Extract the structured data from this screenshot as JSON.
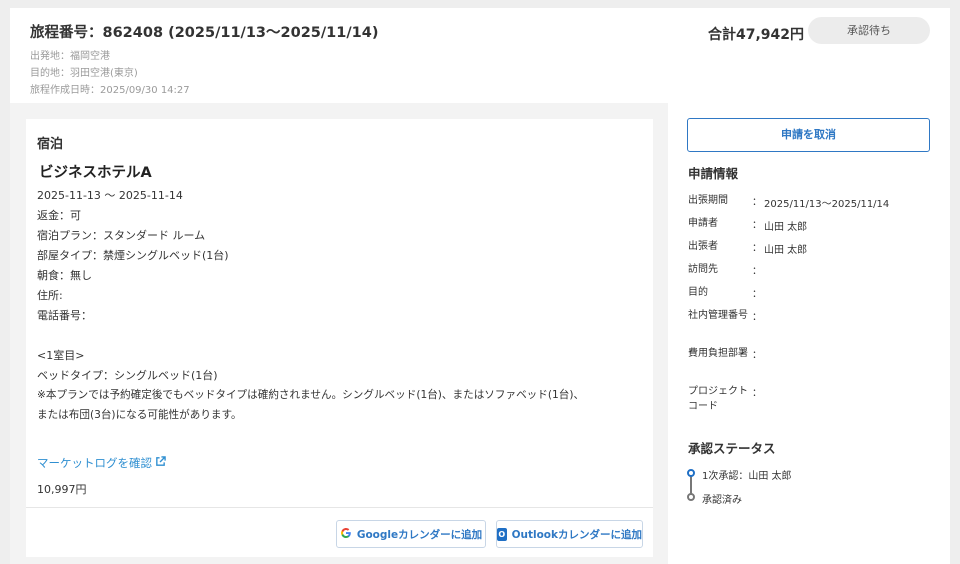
{
  "header": {
    "title": "旅程番号：862408 (2025/11/13〜2025/11/14)",
    "departure": "出発地：福岡空港",
    "destination": "目的地：羽田空港(東京)",
    "created": "旅程作成日時：2025/09/30 14:27",
    "total": "合計47,942円",
    "status": "承認待ち"
  },
  "lodging": {
    "section_title": "宿泊",
    "hotel_name": "ビジネスホテルA",
    "dates": "2025-11-13 〜 2025-11-14",
    "refund": "返金：可",
    "plan": "宿泊プラン：スタンダード ルーム",
    "room_type": "部屋タイプ：禁煙シングルベッド(1台)",
    "breakfast": "朝食：無し",
    "address": "住所:",
    "phone": "電話番号：",
    "room_header": "<1室目>",
    "bed_type": "ベッドタイプ：シングルベッド(1台)",
    "note_line1": "※本プランでは予約確定後でもベッドタイプは確約されません。シングルベッド(1台)、またはソファベッド(1台)、",
    "note_line2": "または布団(3台)になる可能性があります。",
    "market_link": "マーケットログを確認",
    "price": "10,997円",
    "google_button": "Googleカレンダーに追加",
    "outlook_button": "Outlookカレンダーに追加"
  },
  "sidebar": {
    "cancel_button": "申請を取消",
    "info_title": "申請情報",
    "colon": "：",
    "info": [
      {
        "label": "出張期間",
        "value": "2025/11/13〜2025/11/14"
      },
      {
        "label": "申請者",
        "value": "山田 太郎"
      },
      {
        "label": "出張者",
        "value": "山田 太郎"
      },
      {
        "label": "訪問先",
        "value": ""
      },
      {
        "label": "目的",
        "value": ""
      },
      {
        "label": "社内管理番号",
        "value": ""
      },
      {
        "label": "費用負担部署",
        "value": ""
      },
      {
        "label": "プロジェクトコード",
        "value": ""
      }
    ],
    "approval_title": "承認ステータス",
    "steps": [
      {
        "label": "1次承認：山田 太郎"
      },
      {
        "label": "承認済み"
      }
    ]
  },
  "icons": {
    "google": "google-g-icon",
    "outlook": "outlook-icon",
    "external": "external-link-icon"
  },
  "colors": {
    "accent": "#2f78c4",
    "link": "#2f8fd1",
    "muted": "#9a9a9a"
  }
}
